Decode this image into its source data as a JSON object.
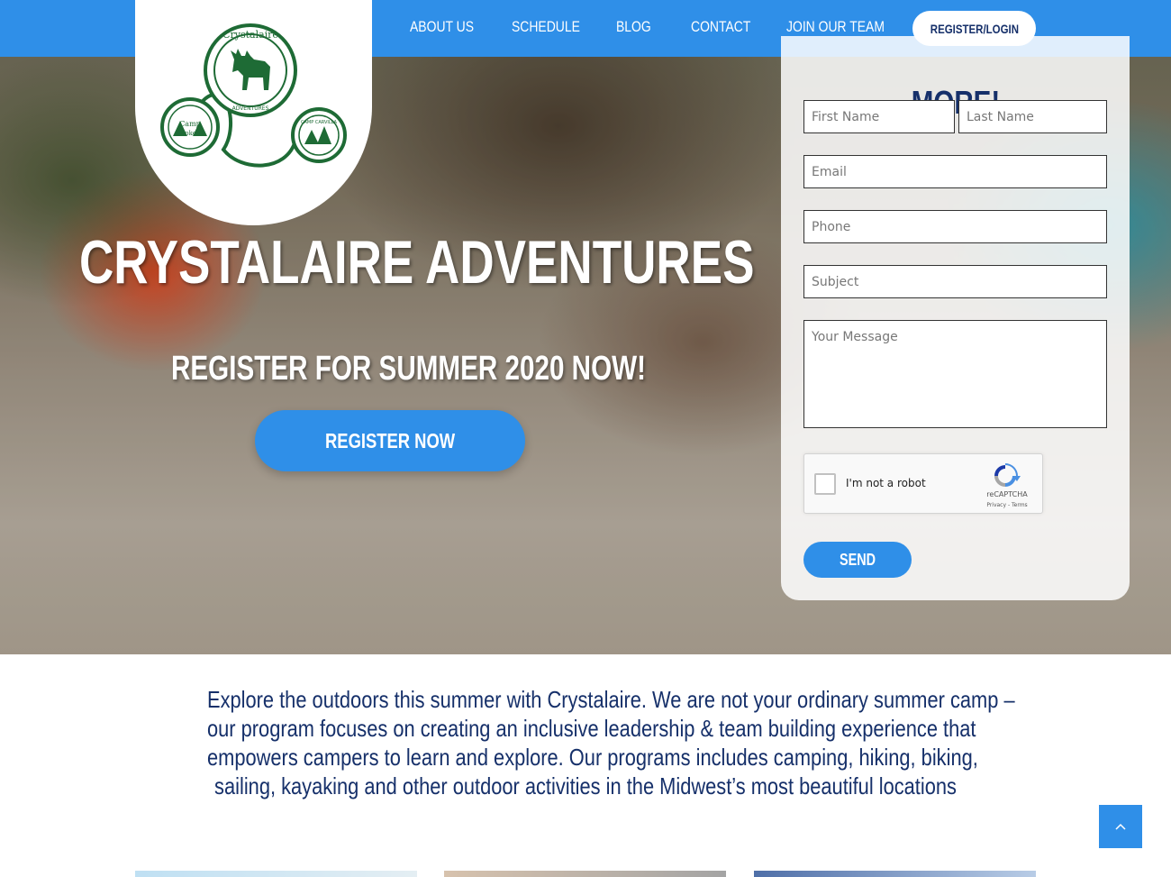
{
  "nav": {
    "items": [
      {
        "label": "ABOUT US"
      },
      {
        "label": "SCHEDULE"
      },
      {
        "label": "BLOG"
      },
      {
        "label": "CONTACT"
      },
      {
        "label": "JOIN OUR TEAM"
      }
    ],
    "register_label": "REGISTER/LOGIN"
  },
  "logo": {
    "top_text": "Crystalaire",
    "arc_text": "ADVENTURES",
    "left_seal_text_1": "Camp",
    "left_seal_text_2": "Lookout",
    "right_seal_text": "CAMP CARVILLA"
  },
  "hero": {
    "title": "CRYSTALAIRE ADVENTURES",
    "subtitle": "REGISTER FOR SUMMER 2020 NOW!",
    "cta_label": "REGISTER NOW"
  },
  "form": {
    "heading": "MORE!",
    "first_name_placeholder": "First Name",
    "last_name_placeholder": "Last Name",
    "email_placeholder": "Email",
    "phone_placeholder": "Phone",
    "subject_placeholder": "Subject",
    "message_placeholder": "Your Message",
    "captcha_label": "I'm not a robot",
    "captcha_brand": "reCAPTCHA",
    "captcha_terms": "Privacy - Terms",
    "send_label": "SEND"
  },
  "intro": {
    "lines": [
      "Explore the outdoors this summer with Crystalaire. We are not your ordinary summer camp –",
      "our program focuses on creating an inclusive leadership & team building experience that",
      "empowers campers to learn and explore. Our programs includes camping, hiking, biking,",
      "sailing,  kayaking and other outdoor activities in the Midwest’s most beautiful locations"
    ]
  },
  "colors": {
    "brand_blue": "#2f8fe8",
    "navy_text": "#16306a",
    "logo_green": "#1e6b35"
  },
  "icons": {
    "back_to_top": "chevron-up-icon",
    "captcha": "recaptcha-icon"
  }
}
